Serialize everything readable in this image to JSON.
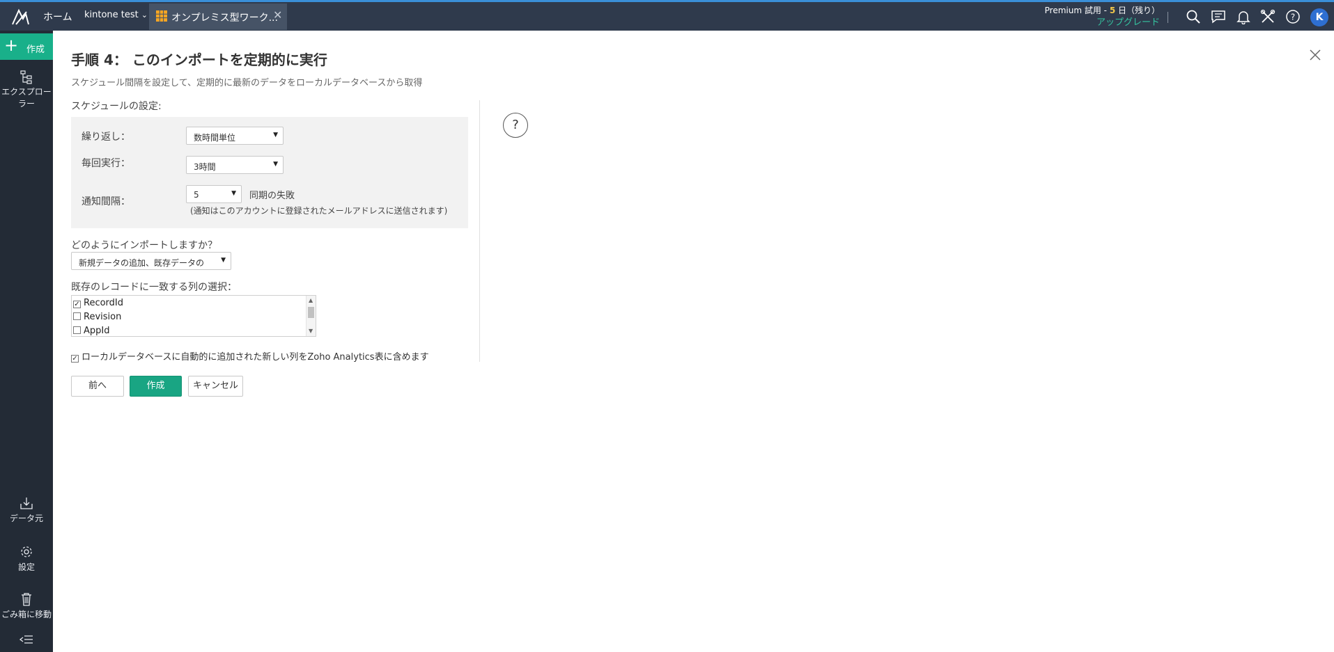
{
  "topbar": {
    "home": "ホーム",
    "workspace": "kintone test",
    "tab_label": "オンプレミス型ワーク...",
    "trial_text_pre": "Premium 試用 - ",
    "trial_days": "5",
    "trial_text_post": " 日（残り）",
    "upgrade": "アップグレード",
    "avatar": "K",
    "icons": [
      "search-icon",
      "chat-icon",
      "bell-icon",
      "tools-icon",
      "help-icon"
    ]
  },
  "sidebar": {
    "create": "作成",
    "explorer": "エクスプローラー",
    "datasource": "データ元",
    "settings": "設定",
    "trash": "ごみ箱に移動"
  },
  "main": {
    "title": "手順 4： このインポートを定期的に実行",
    "subtitle": "スケジュール間隔を設定して、定期的に最新のデータをローカルデータベースから取得",
    "schedule_label": "スケジュールの設定:",
    "repeat_label": "繰り返し：",
    "repeat_value": "数時間単位",
    "every_label": "毎回実行：",
    "every_value": "3時間",
    "notify_label": "通知間隔：",
    "notify_value": "5",
    "notify_suffix": "同期の失敗",
    "notify_note": "(通知はこのアカウントに登録されたメールアドレスに送信されます)",
    "how_label": "どのようにインポートしますか？",
    "how_value": "新規データの追加、既存データの",
    "match_label": "既存のレコードに一致する列の選択：",
    "columns": [
      {
        "name": "RecordId",
        "checked": true
      },
      {
        "name": "Revision",
        "checked": false
      },
      {
        "name": "AppId",
        "checked": false
      }
    ],
    "include_new_cols": "ローカルデータベースに自動的に追加された新しい列をZoho Analytics表に含めます",
    "help": "?",
    "buttons": {
      "prev": "前へ",
      "create": "作成",
      "cancel": "キャンセル"
    }
  },
  "colors": {
    "topbar": "#2f3a4c",
    "sidebar": "#232b36",
    "accent": "#19b08a",
    "upgrade": "#35c4a0"
  }
}
